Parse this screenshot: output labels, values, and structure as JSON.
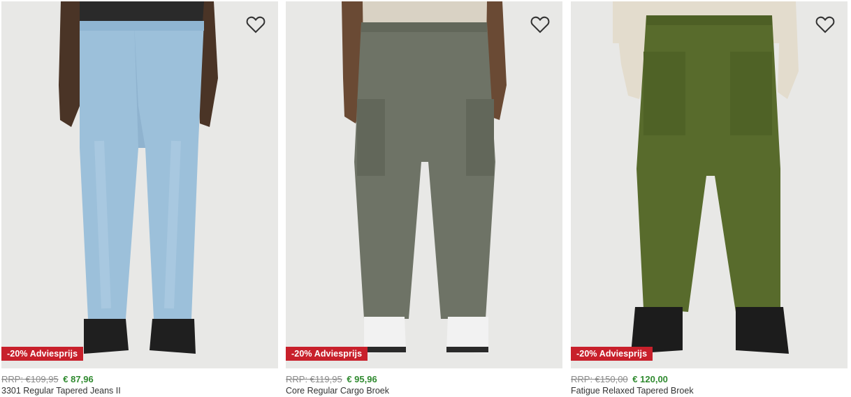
{
  "products": [
    {
      "badge": "-20% Adviesprijs",
      "rrp": "RRP: €109,95",
      "price": "€ 87,96",
      "name": "3301 Regular Tapered Jeans II",
      "image": "light-blue-denim-jeans-photo",
      "wishlist_icon": "heart-outline-icon"
    },
    {
      "badge": "-20% Adviesprijs",
      "rrp": "RRP: €119,95",
      "price": "€ 95,96",
      "name": "Core Regular Cargo Broek",
      "image": "grey-green-cargo-pants-photo",
      "wishlist_icon": "heart-outline-icon"
    },
    {
      "badge": "-20% Adviesprijs",
      "rrp": "RRP: €150,00",
      "price": "€ 120,00",
      "name": "Fatigue Relaxed Tapered Broek",
      "image": "olive-fatigue-pants-photo",
      "wishlist_icon": "heart-outline-icon"
    }
  ],
  "colors": {
    "badge_bg": "#c8202b",
    "sale_price": "#2f8a2f",
    "rrp": "#8a8a8a",
    "photo_bg": "#e9e9e7"
  }
}
